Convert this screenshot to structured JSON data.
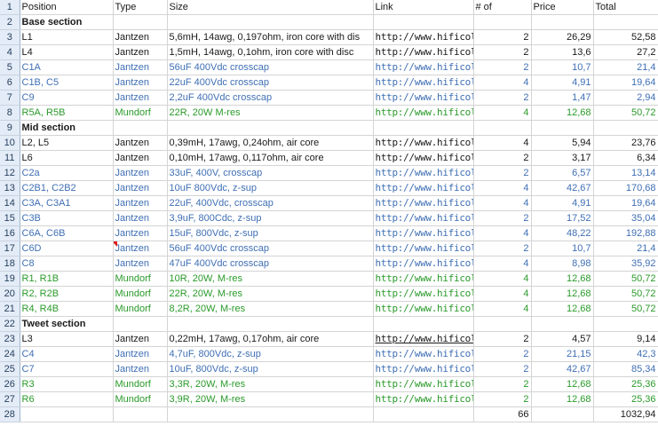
{
  "headers": [
    "Position",
    "Type",
    "Size",
    "Link",
    "# of",
    "Price",
    "Total"
  ],
  "rows": [
    {
      "n": "2",
      "kind": "section",
      "label": "Base section"
    },
    {
      "n": "3",
      "kind": "item",
      "color": "black",
      "c": [
        "L1",
        "Jantzen",
        "5,6mH, 14awg, 0,197ohm, iron core with dis",
        "http://www.hificolle",
        "2",
        "26,29",
        "52,58"
      ]
    },
    {
      "n": "4",
      "kind": "item",
      "color": "black",
      "c": [
        "L4",
        "Jantzen",
        "1,5mH, 14awg, 0,1ohm, iron core with disc",
        "http://www.hificolle",
        "2",
        "13,6",
        "27,2"
      ]
    },
    {
      "n": "5",
      "kind": "item",
      "color": "blue",
      "c": [
        "C1A",
        "Jantzen",
        "56uF 400Vdc crosscap",
        "http://www.hificolle",
        "2",
        "10,7",
        "21,4"
      ]
    },
    {
      "n": "6",
      "kind": "item",
      "color": "blue",
      "c": [
        "C1B, C5",
        "Jantzen",
        "22uF 400Vdc crosscap",
        "http://www.hificolle",
        "4",
        "4,91",
        "19,64"
      ]
    },
    {
      "n": "7",
      "kind": "item",
      "color": "blue",
      "c": [
        "C9",
        "Jantzen",
        "2,2uF 400Vdc crosscap",
        "http://www.hificolle",
        "2",
        "1,47",
        "2,94"
      ]
    },
    {
      "n": "8",
      "kind": "item",
      "color": "green",
      "c": [
        "R5A, R5B",
        "Mundorf",
        "22R, 20W M-res",
        "http://www.hificolle",
        "4",
        "12,68",
        "50,72"
      ]
    },
    {
      "n": "9",
      "kind": "section",
      "label": "Mid section"
    },
    {
      "n": "10",
      "kind": "item",
      "color": "black",
      "c": [
        "L2, L5",
        "Jantzen",
        "0,39mH, 17awg, 0,24ohm, air core",
        "http://www.hificolle",
        "4",
        "5,94",
        "23,76"
      ]
    },
    {
      "n": "11",
      "kind": "item",
      "color": "black",
      "c": [
        "L6",
        "Jantzen",
        "0,10mH, 17awg, 0,117ohm, air core",
        "http://www.hificolle",
        "2",
        "3,17",
        "6,34"
      ]
    },
    {
      "n": "12",
      "kind": "item",
      "color": "blue",
      "c": [
        "C2a",
        "Jantzen",
        "33uF, 400V, crosscap",
        "http://www.hificolle",
        "2",
        "6,57",
        "13,14"
      ]
    },
    {
      "n": "13",
      "kind": "item",
      "color": "blue",
      "c": [
        "C2B1, C2B2",
        "Jantzen",
        "10uF 800Vdc, z-sup",
        "http://www.hificolle",
        "4",
        "42,67",
        "170,68"
      ]
    },
    {
      "n": "14",
      "kind": "item",
      "color": "blue",
      "c": [
        "C3A, C3A1",
        "Jantzen",
        "22uF, 400Vdc, crosscap",
        "http://www.hificolle",
        "4",
        "4,91",
        "19,64"
      ]
    },
    {
      "n": "15",
      "kind": "item",
      "color": "blue",
      "c": [
        "C3B",
        "Jantzen",
        "3,9uF, 800Cdc, z-sup",
        "http://www.hificolle",
        "2",
        "17,52",
        "35,04"
      ]
    },
    {
      "n": "16",
      "kind": "item",
      "color": "blue",
      "c": [
        "C6A, C6B",
        "Jantzen",
        "15uF, 800Vdc, z-sup",
        "http://www.hificolle",
        "4",
        "48,22",
        "192,88"
      ]
    },
    {
      "n": "17",
      "kind": "item",
      "color": "blue",
      "comment": true,
      "c": [
        "C6D",
        "Jantzen",
        "56uF 400Vdc crosscap",
        "http://www.hificolle",
        "2",
        "10,7",
        "21,4"
      ]
    },
    {
      "n": "18",
      "kind": "item",
      "color": "blue",
      "c": [
        "C8",
        "Jantzen",
        "47uF 400Vdc crosscap",
        "http://www.hificolle",
        "4",
        "8,98",
        "35,92"
      ]
    },
    {
      "n": "19",
      "kind": "item",
      "color": "green",
      "c": [
        "R1, R1B",
        "Mundorf",
        "10R, 20W, M-res",
        "http://www.hificolle",
        "4",
        "12,68",
        "50,72"
      ]
    },
    {
      "n": "20",
      "kind": "item",
      "color": "green",
      "c": [
        "R2, R2B",
        "Mundorf",
        "22R, 20W, M-res",
        "http://www.hificolle",
        "4",
        "12,68",
        "50,72"
      ]
    },
    {
      "n": "21",
      "kind": "item",
      "color": "green",
      "c": [
        "R4, R4B",
        "Mundorf",
        "8,2R, 20W, M-res",
        "http://www.hificolle",
        "4",
        "12,68",
        "50,72"
      ]
    },
    {
      "n": "22",
      "kind": "section",
      "label": "Tweet section"
    },
    {
      "n": "23",
      "kind": "item",
      "color": "black",
      "underline": true,
      "c": [
        "L3",
        "Jantzen",
        "0,22mH, 17awg, 0,17ohm, air core",
        "http://www.hificolle",
        "2",
        "4,57",
        "9,14"
      ]
    },
    {
      "n": "24",
      "kind": "item",
      "color": "blue",
      "c": [
        "C4",
        "Jantzen",
        "4,7uF, 800Vdc, z-sup",
        "http://www.hificolle",
        "2",
        "21,15",
        "42,3"
      ]
    },
    {
      "n": "25",
      "kind": "item",
      "color": "blue",
      "c": [
        "C7",
        "Jantzen",
        "10uF, 800Vdc, z-sup",
        "http://www.hificolle",
        "2",
        "42,67",
        "85,34"
      ]
    },
    {
      "n": "26",
      "kind": "item",
      "color": "green",
      "c": [
        "R3",
        "Mundorf",
        "3,3R, 20W, M-res",
        "http://www.hificolle",
        "2",
        "12,68",
        "25,36"
      ]
    },
    {
      "n": "27",
      "kind": "item",
      "color": "green",
      "c": [
        "R6",
        "Mundorf",
        "3,9R, 20W, M-res",
        "http://www.hificolle",
        "2",
        "12,68",
        "25,36"
      ]
    }
  ],
  "totals": {
    "n": "28",
    "count": "66",
    "total": "1032,94"
  },
  "header_row_number": "1",
  "colors": {
    "black": "#1a1a1a",
    "blue": "#3f6fb4",
    "green": "#2a9a2a",
    "row_header_bg": "#e4ecf7",
    "grid": "#d4d4d4",
    "comment": "#e0201c"
  }
}
